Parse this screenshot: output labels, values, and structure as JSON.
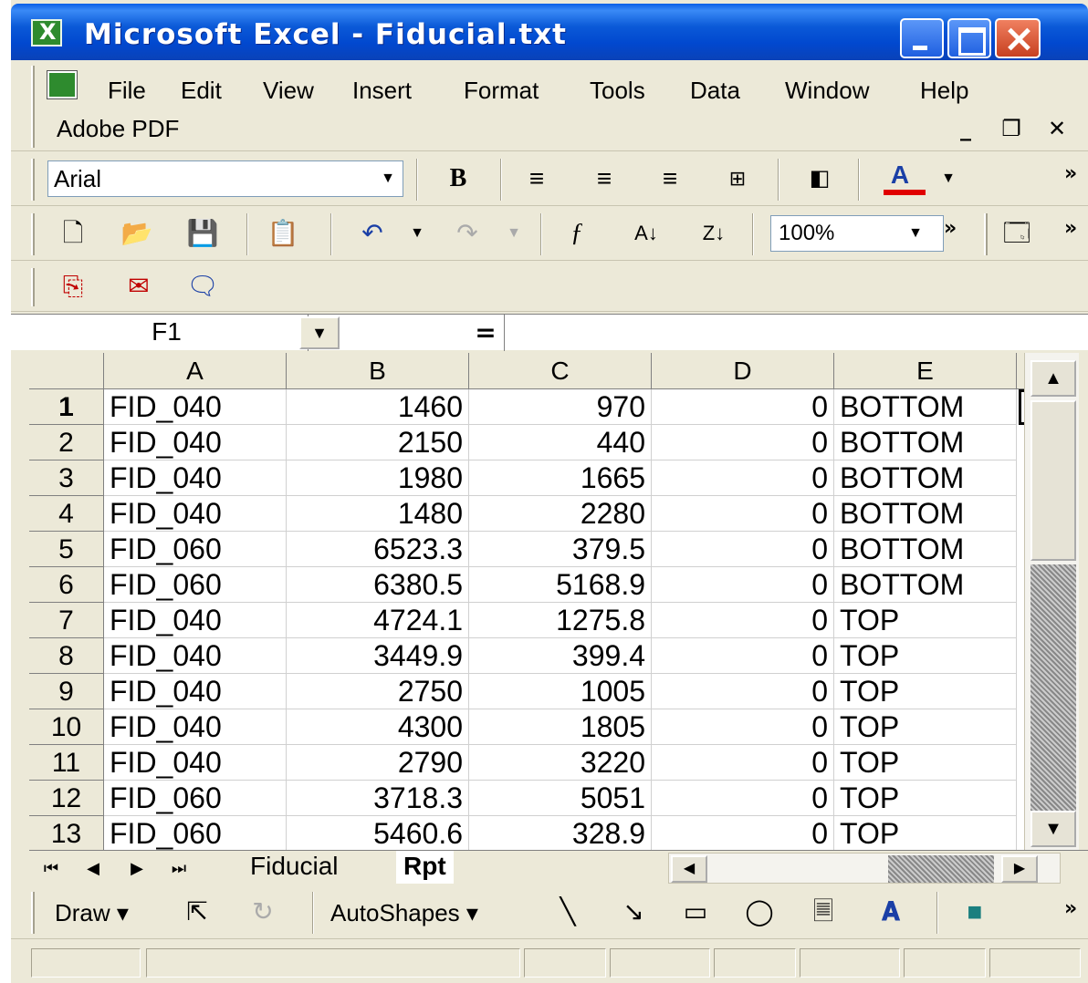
{
  "window": {
    "title": "Microsoft Excel - Fiducial.txt"
  },
  "menu": {
    "items": [
      "File",
      "Edit",
      "View",
      "Insert",
      "Format",
      "Tools",
      "Data",
      "Window",
      "Help"
    ],
    "adobe": "Adobe PDF"
  },
  "formatting": {
    "font": "Arial",
    "bold_label": "B",
    "font_color_label": "A"
  },
  "standard": {
    "zoom": "100%"
  },
  "formula": {
    "namebox": "F1",
    "equals": "=",
    "value": ""
  },
  "grid": {
    "columns": [
      "A",
      "B",
      "C",
      "D",
      "E"
    ],
    "rows": [
      {
        "n": "1",
        "cells": [
          "FID_040",
          "1460",
          "970",
          "0",
          "BOTTOM"
        ]
      },
      {
        "n": "2",
        "cells": [
          "FID_040",
          "2150",
          "440",
          "0",
          "BOTTOM"
        ]
      },
      {
        "n": "3",
        "cells": [
          "FID_040",
          "1980",
          "1665",
          "0",
          "BOTTOM"
        ]
      },
      {
        "n": "4",
        "cells": [
          "FID_040",
          "1480",
          "2280",
          "0",
          "BOTTOM"
        ]
      },
      {
        "n": "5",
        "cells": [
          "FID_060",
          "6523.3",
          "379.5",
          "0",
          "BOTTOM"
        ]
      },
      {
        "n": "6",
        "cells": [
          "FID_060",
          "6380.5",
          "5168.9",
          "0",
          "BOTTOM"
        ]
      },
      {
        "n": "7",
        "cells": [
          "FID_040",
          "4724.1",
          "1275.8",
          "0",
          "TOP"
        ]
      },
      {
        "n": "8",
        "cells": [
          "FID_040",
          "3449.9",
          "399.4",
          "0",
          "TOP"
        ]
      },
      {
        "n": "9",
        "cells": [
          "FID_040",
          "2750",
          "1005",
          "0",
          "TOP"
        ]
      },
      {
        "n": "10",
        "cells": [
          "FID_040",
          "4300",
          "1805",
          "0",
          "TOP"
        ]
      },
      {
        "n": "11",
        "cells": [
          "FID_040",
          "2790",
          "3220",
          "0",
          "TOP"
        ]
      },
      {
        "n": "12",
        "cells": [
          "FID_060",
          "3718.3",
          "5051",
          "0",
          "TOP"
        ]
      },
      {
        "n": "13",
        "cells": [
          "FID_060",
          "5460.6",
          "328.9",
          "0",
          "TOP"
        ]
      }
    ]
  },
  "sheets": {
    "tabs": [
      "Fiducial",
      "Rpt"
    ],
    "active": "Rpt"
  },
  "drawing": {
    "draw_label": "Draw",
    "autoshapes_label": "AutoShapes"
  },
  "colors": {
    "titlebar": "#0148cf",
    "chrome": "#ece9d8",
    "font_color_bar": "#e00000"
  }
}
